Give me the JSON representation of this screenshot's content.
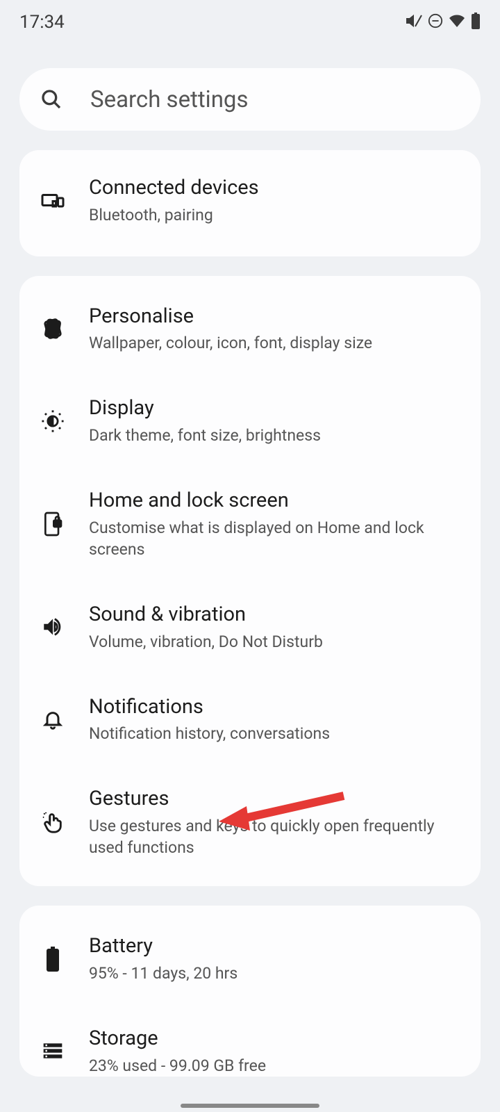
{
  "status_bar": {
    "time": "17:34"
  },
  "search": {
    "placeholder": "Search settings"
  },
  "group1": {
    "items": [
      {
        "title": "Connected devices",
        "subtitle": "Bluetooth, pairing"
      }
    ]
  },
  "group2": {
    "items": [
      {
        "title": "Personalise",
        "subtitle": "Wallpaper, colour, icon, font, display size"
      },
      {
        "title": "Display",
        "subtitle": "Dark theme, font size, brightness"
      },
      {
        "title": "Home and lock screen",
        "subtitle": "Customise what is displayed on Home and lock screens"
      },
      {
        "title": "Sound & vibration",
        "subtitle": "Volume, vibration, Do Not Disturb"
      },
      {
        "title": "Notifications",
        "subtitle": "Notification history, conversations"
      },
      {
        "title": "Gestures",
        "subtitle": "Use gestures and keys to quickly open frequently used functions"
      }
    ]
  },
  "group3": {
    "items": [
      {
        "title": "Battery",
        "subtitle": "95% - 11 days, 20 hrs"
      },
      {
        "title": "Storage",
        "subtitle": "23% used - 99.09 GB free"
      }
    ]
  }
}
